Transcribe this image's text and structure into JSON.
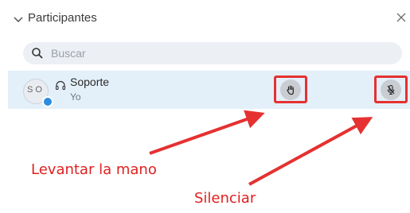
{
  "panel": {
    "title": "Participantes",
    "collapse_icon": "chevron-down-icon",
    "close_icon": "close-icon"
  },
  "search": {
    "placeholder": "Buscar",
    "icon": "search-icon"
  },
  "participants": [
    {
      "avatar_initials": "SO",
      "name": "Soporte",
      "subtitle": "Yo",
      "role_icon": "headset-icon",
      "actions": [
        {
          "name": "raise-hand",
          "icon": "hand-icon"
        },
        {
          "name": "mute",
          "icon": "mic-off-icon"
        }
      ]
    }
  ],
  "annotations": {
    "raise_hand_label": "Levantar la mano",
    "mute_label": "Silenciar",
    "color": "#e02020"
  }
}
